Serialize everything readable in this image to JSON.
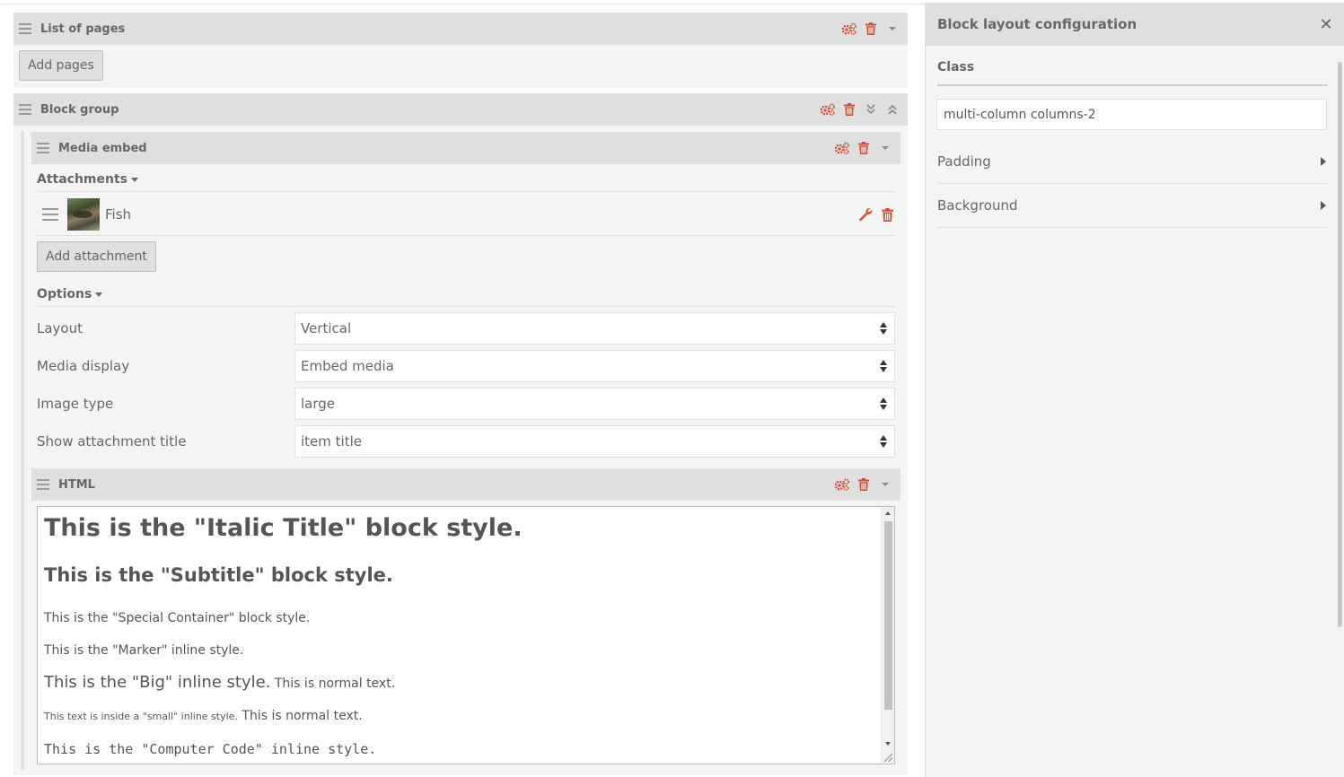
{
  "blocks": {
    "list_of_pages": {
      "title": "List of pages",
      "add_button": "Add pages"
    },
    "block_group": {
      "title": "Block group"
    },
    "media_embed": {
      "title": "Media embed",
      "attachments_label": "Attachments",
      "attachments": [
        {
          "name": "Fish"
        }
      ],
      "add_attachment_button": "Add attachment",
      "options_label": "Options",
      "options": [
        {
          "label": "Layout",
          "value": "Vertical"
        },
        {
          "label": "Media display",
          "value": "Embed media"
        },
        {
          "label": "Image type",
          "value": "large"
        },
        {
          "label": "Show attachment title",
          "value": "item title"
        }
      ]
    },
    "html": {
      "title": "HTML",
      "content": {
        "italic_title": "This is the \"Italic Title\" block style.",
        "subtitle": "This is the \"Subtitle\" block style.",
        "special_container": "This is the \"Special Container\" block style.",
        "marker": "This is the \"Marker\" inline style.",
        "big": "This is the \"Big\" inline style.",
        "normal_after_big": " This is normal text.",
        "small": "This text is inside a \"small\" inline style.",
        "normal_after_small": " This is normal text.",
        "code": "This is the \"Computer Code\" inline style."
      }
    }
  },
  "sidebar": {
    "title": "Block layout configuration",
    "close_glyph": "✕",
    "class_label": "Class",
    "class_value": "multi-column columns-2",
    "sections": [
      {
        "label": "Padding"
      },
      {
        "label": "Background"
      }
    ]
  },
  "icons": {
    "settings": "cogs-icon",
    "delete": "trash-icon",
    "collapse": "caret-down-icon",
    "expand_all": "double-chevron-down-icon",
    "collapse_all": "double-chevron-up-icon",
    "edit": "wrench-icon"
  },
  "colors": {
    "action_red": "#c9513a",
    "header_gray": "#dfdfdf",
    "panel_gray": "#f4f4f4",
    "text": "#676767"
  }
}
